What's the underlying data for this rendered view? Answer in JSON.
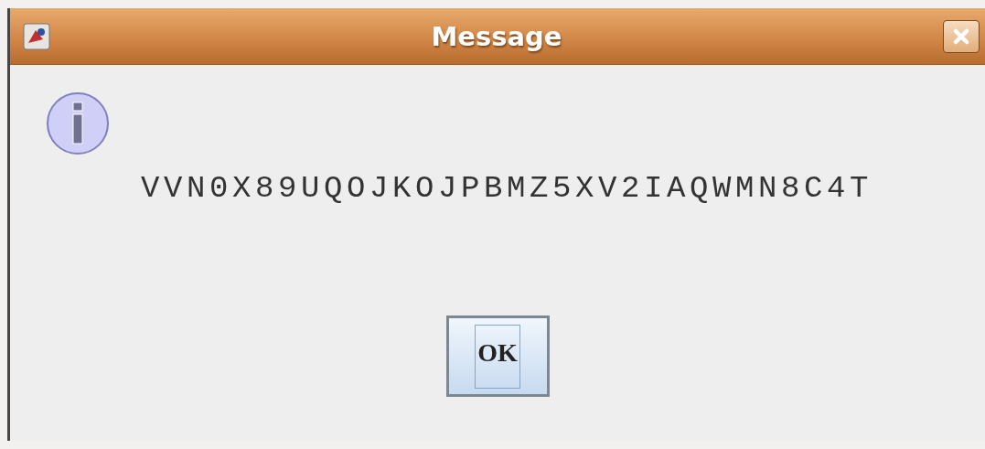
{
  "window": {
    "title": "Message"
  },
  "message": "VVN0X89UQOJKOJPBMZ5XV2IAQWMN8C4T",
  "buttons": [
    {
      "label": "OK",
      "focused": true
    }
  ]
}
